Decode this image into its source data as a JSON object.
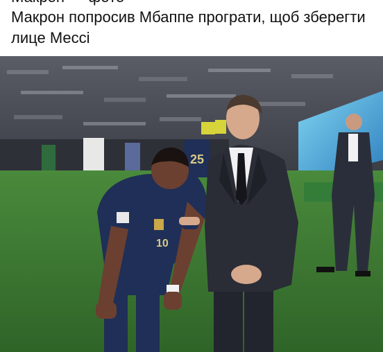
{
  "post": {
    "caption_clipped_line": "Макрон — фото",
    "caption": "Макрон попросив Мбаппе програти, щоб зберегти лице Мессі"
  },
  "photo": {
    "player_number": "10",
    "bg_player_number": "25",
    "colors": {
      "pitch": "#3f7a34",
      "crowd": "#4a4a52",
      "kit": "#1f2f57",
      "suit": "#23252e",
      "shirt": "#f2f2f4",
      "skin_player": "#6b4030",
      "skin_man": "#d6a88c"
    }
  }
}
